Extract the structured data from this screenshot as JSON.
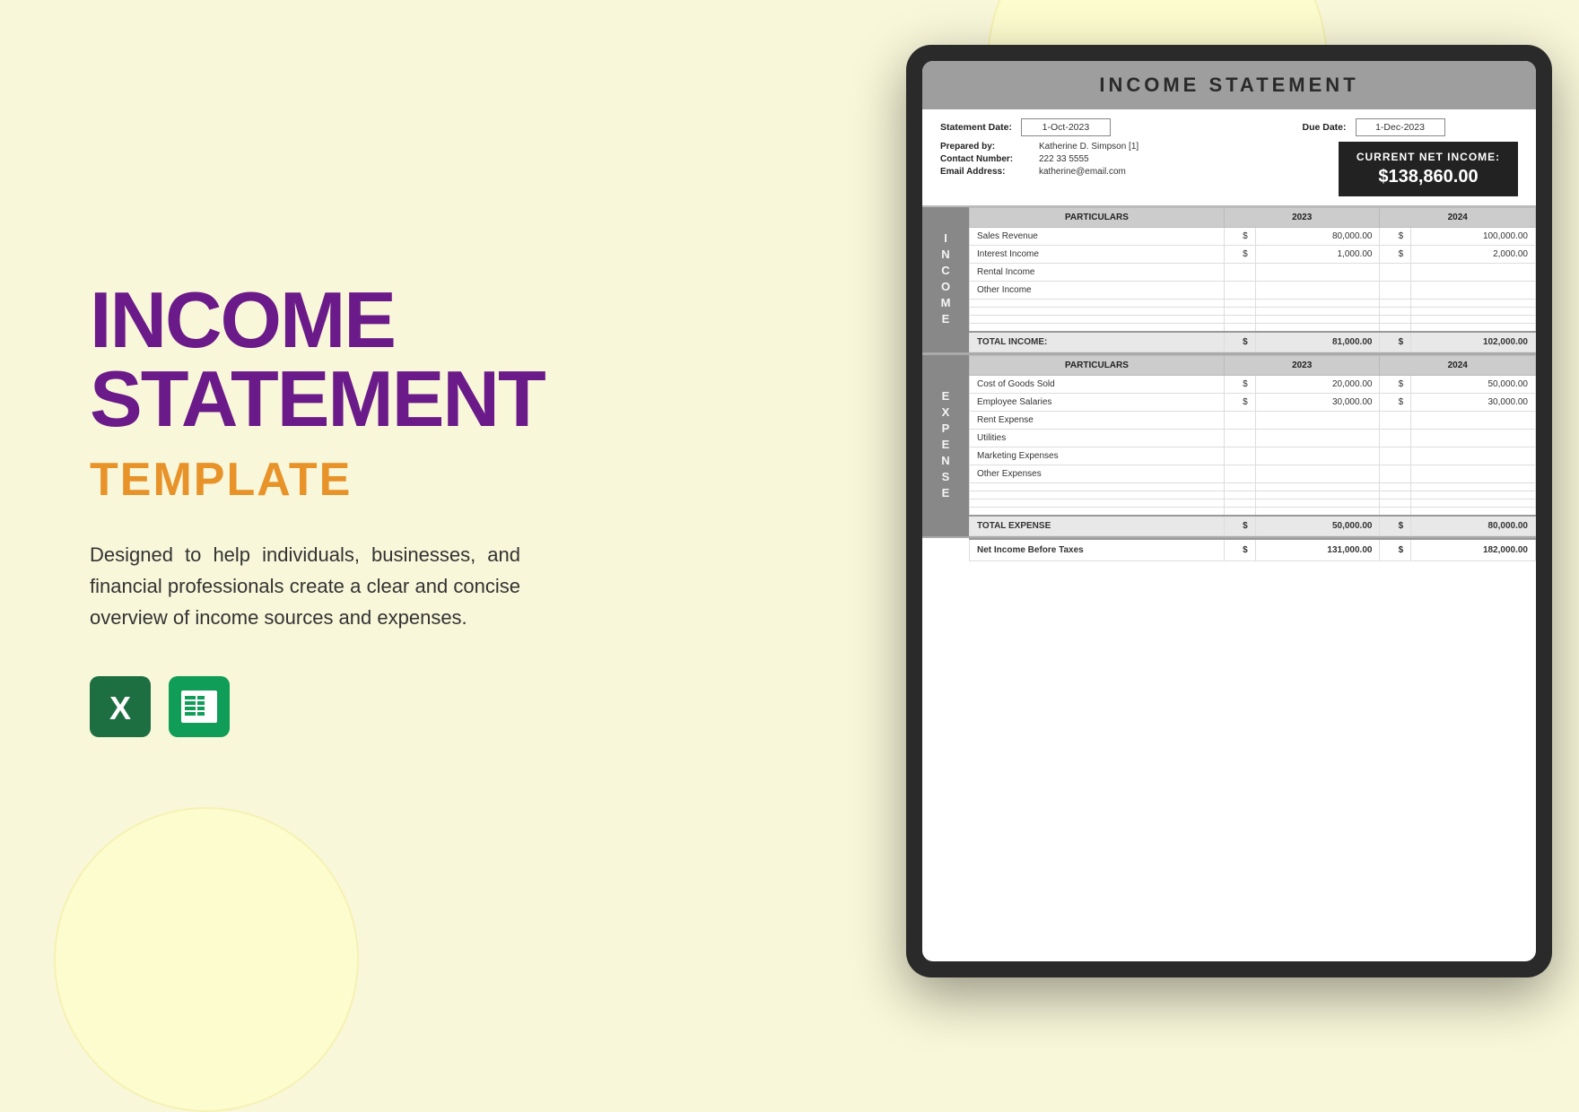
{
  "background": {
    "color": "#f9f7d9"
  },
  "left": {
    "title_line1": "INCOME",
    "title_line2": "STATEMENT",
    "subtitle": "TEMPLATE",
    "description": "Designed to help individuals, businesses, and financial professionals create a clear and concise overview of income sources and expenses.",
    "icon1_label": "Excel Icon",
    "icon2_label": "Sheets Icon"
  },
  "document": {
    "title": "INCOME STATEMENT",
    "statement_date_label": "Statement Date:",
    "statement_date_value": "1-Oct-2023",
    "due_date_label": "Due Date:",
    "due_date_value": "1-Dec-2023",
    "prepared_by_label": "Prepared by:",
    "prepared_by_value": "Katherine D. Simpson [1]",
    "contact_label": "Contact Number:",
    "contact_value": "222 33 5555",
    "email_label": "Email Address:",
    "email_value": "katherine@email.com",
    "current_net_label": "CURRENT NET INCOME:",
    "current_net_value": "$138,860.00",
    "income_section_label": "INCOME",
    "income_table": {
      "headers": [
        "PARTICULARS",
        "2023",
        "2024"
      ],
      "rows": [
        {
          "particulars": "Sales Revenue",
          "currency2023": "$",
          "amount2023": "80,000.00",
          "currency2024": "$",
          "amount2024": "100,000.00"
        },
        {
          "particulars": "Interest Income",
          "currency2023": "$",
          "amount2023": "1,000.00",
          "currency2024": "$",
          "amount2024": "2,000.00"
        },
        {
          "particulars": "Rental Income",
          "currency2023": "",
          "amount2023": "",
          "currency2024": "",
          "amount2024": ""
        },
        {
          "particulars": "Other Income",
          "currency2023": "",
          "amount2023": "",
          "currency2024": "",
          "amount2024": ""
        },
        {
          "particulars": "",
          "currency2023": "",
          "amount2023": "",
          "currency2024": "",
          "amount2024": ""
        },
        {
          "particulars": "",
          "currency2023": "",
          "amount2023": "",
          "currency2024": "",
          "amount2024": ""
        },
        {
          "particulars": "",
          "currency2023": "",
          "amount2023": "",
          "currency2024": "",
          "amount2024": ""
        },
        {
          "particulars": "",
          "currency2023": "",
          "amount2023": "",
          "currency2024": "",
          "amount2024": ""
        }
      ],
      "total_label": "TOTAL INCOME:",
      "total_currency2023": "$",
      "total_amount2023": "81,000.00",
      "total_currency2024": "$",
      "total_amount2024": "102,000.00"
    },
    "expense_section_label": "EXPENSE",
    "expense_table": {
      "headers": [
        "PARTICULARS",
        "2023",
        "2024"
      ],
      "rows": [
        {
          "particulars": "Cost of Goods Sold",
          "currency2023": "$",
          "amount2023": "20,000.00",
          "currency2024": "$",
          "amount2024": "50,000.00"
        },
        {
          "particulars": "Employee Salaries",
          "currency2023": "$",
          "amount2023": "30,000.00",
          "currency2024": "$",
          "amount2024": "30,000.00"
        },
        {
          "particulars": "Rent Expense",
          "currency2023": "",
          "amount2023": "",
          "currency2024": "",
          "amount2024": ""
        },
        {
          "particulars": "Utilities",
          "currency2023": "",
          "amount2023": "",
          "currency2024": "",
          "amount2024": ""
        },
        {
          "particulars": "Marketing Expenses",
          "currency2023": "",
          "amount2023": "",
          "currency2024": "",
          "amount2024": ""
        },
        {
          "particulars": "Other Expenses",
          "currency2023": "",
          "amount2023": "",
          "currency2024": "",
          "amount2024": ""
        },
        {
          "particulars": "",
          "currency2023": "",
          "amount2023": "",
          "currency2024": "",
          "amount2024": ""
        },
        {
          "particulars": "",
          "currency2023": "",
          "amount2023": "",
          "currency2024": "",
          "amount2024": ""
        },
        {
          "particulars": "",
          "currency2023": "",
          "amount2023": "",
          "currency2024": "",
          "amount2024": ""
        },
        {
          "particulars": "",
          "currency2023": "",
          "amount2023": "",
          "currency2024": "",
          "amount2024": ""
        }
      ],
      "total_label": "TOTAL EXPENSE",
      "total_currency2023": "$",
      "total_amount2023": "50,000.00",
      "total_currency2024": "$",
      "total_amount2024": "80,000.00"
    },
    "net_income_label": "Net Income Before Taxes",
    "net_currency2023": "$",
    "net_amount2023": "131,000.00",
    "net_currency2024": "$",
    "net_amount2024": "182,000.00"
  }
}
